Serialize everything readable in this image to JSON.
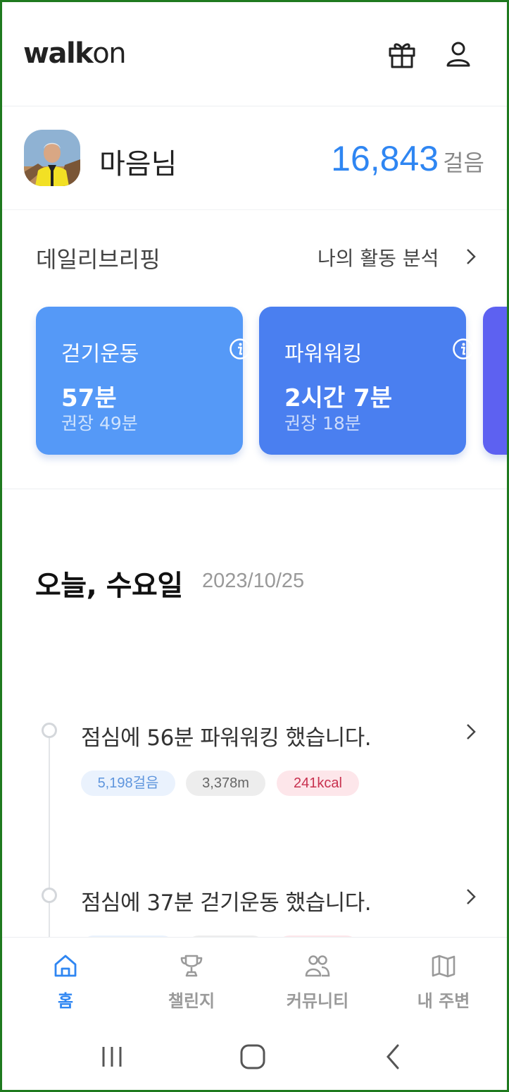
{
  "app": {
    "logo_bold": "walk",
    "logo_light": "on"
  },
  "header": {
    "icons": [
      "gift-icon",
      "user-icon"
    ]
  },
  "profile": {
    "name": "마음님",
    "steps": "16,843",
    "steps_unit": "걸음"
  },
  "briefing": {
    "title": "데일리브리핑",
    "link_label": "나의 활동 분석",
    "cards": [
      {
        "title": "걷기운동",
        "value": "57분",
        "sub": "권장 49분"
      },
      {
        "title": "파워워킹",
        "value": "2시간 7분",
        "sub": "권장 18분"
      }
    ]
  },
  "today": {
    "title": "오늘, 수요일",
    "date": "2023/10/25"
  },
  "timeline": [
    {
      "text": "점심에 56분 파워워킹 했습니다.",
      "steps": "5,198걸음",
      "distance": "3,378m",
      "kcal": "241kcal"
    },
    {
      "text": "점심에 37분 걷기운동 했습니다."
    }
  ],
  "nav": {
    "items": [
      {
        "label": "홈",
        "icon": "home-icon",
        "active": true
      },
      {
        "label": "챌린지",
        "icon": "trophy-icon"
      },
      {
        "label": "커뮤니티",
        "icon": "community-icon"
      },
      {
        "label": "내 주변",
        "icon": "map-icon"
      }
    ]
  },
  "colors": {
    "accent": "#2f86f2",
    "card1": "#5599f7",
    "card2": "#4a7ff0",
    "card3": "#5d61f1",
    "kcal": "#c8314f"
  }
}
